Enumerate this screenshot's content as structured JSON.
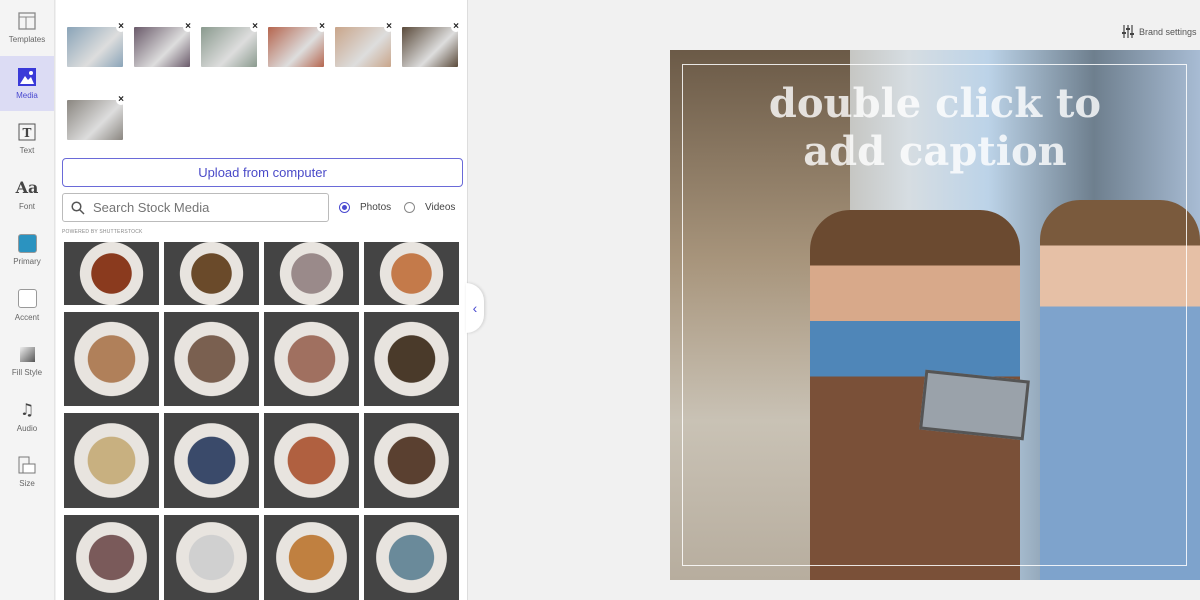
{
  "sidebar": {
    "items": [
      {
        "label": "Templates",
        "icon": "templates-icon"
      },
      {
        "label": "Media",
        "icon": "image-icon",
        "active": true
      },
      {
        "label": "Text",
        "icon": "text-icon"
      },
      {
        "label": "Font",
        "icon": "font-icon",
        "glyph": "Aa"
      },
      {
        "label": "Primary",
        "icon": "primary-color-swatch",
        "color": "#2b93c0"
      },
      {
        "label": "Accent",
        "icon": "accent-color-swatch",
        "color": "#ffffff"
      },
      {
        "label": "Fill Style",
        "icon": "fill-style-icon"
      },
      {
        "label": "Audio",
        "icon": "music-icon",
        "glyph": "♫"
      },
      {
        "label": "Size",
        "icon": "size-icon"
      }
    ]
  },
  "media": {
    "upload_label": "Upload from computer",
    "search_placeholder": "Search Stock Media",
    "photos_label": "Photos",
    "videos_label": "Videos",
    "selected_type": "Photos",
    "powered_by": "POWERED BY SHUTTERSTOCK",
    "remove_glyph": "×",
    "uploaded_count": 7,
    "stock_count": 16
  },
  "canvas": {
    "caption": "double click to add caption",
    "brand_settings": "Brand settings"
  },
  "colors": {
    "accent": "#4a4ad0",
    "primary": "#2b93c0"
  }
}
